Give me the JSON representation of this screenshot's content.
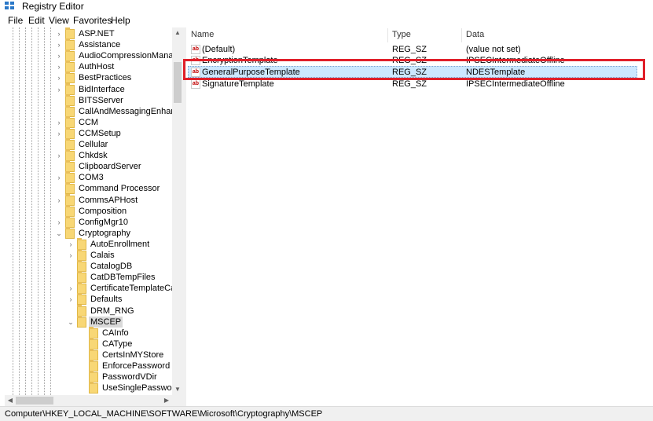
{
  "window": {
    "title": "Registry Editor"
  },
  "menu": [
    "File",
    "Edit",
    "View",
    "Favorites",
    "Help"
  ],
  "tree": {
    "items": [
      {
        "label": "ASP.NET",
        "expander": "›",
        "depth": 1
      },
      {
        "label": "Assistance",
        "expander": "›",
        "depth": 1
      },
      {
        "label": "AudioCompressionManager",
        "expander": "›",
        "depth": 1
      },
      {
        "label": "AuthHost",
        "expander": "›",
        "depth": 1
      },
      {
        "label": "BestPractices",
        "expander": "›",
        "depth": 1
      },
      {
        "label": "BidInterface",
        "expander": "›",
        "depth": 1
      },
      {
        "label": "BITSServer",
        "expander": "",
        "depth": 1
      },
      {
        "label": "CallAndMessagingEnhancem",
        "expander": "",
        "depth": 1
      },
      {
        "label": "CCM",
        "expander": "›",
        "depth": 1
      },
      {
        "label": "CCMSetup",
        "expander": "›",
        "depth": 1
      },
      {
        "label": "Cellular",
        "expander": "",
        "depth": 1
      },
      {
        "label": "Chkdsk",
        "expander": "›",
        "depth": 1
      },
      {
        "label": "ClipboardServer",
        "expander": "",
        "depth": 1
      },
      {
        "label": "COM3",
        "expander": "›",
        "depth": 1
      },
      {
        "label": "Command Processor",
        "expander": "",
        "depth": 1
      },
      {
        "label": "CommsAPHost",
        "expander": "›",
        "depth": 1
      },
      {
        "label": "Composition",
        "expander": "",
        "depth": 1
      },
      {
        "label": "ConfigMgr10",
        "expander": "›",
        "depth": 1
      },
      {
        "label": "Cryptography",
        "expander": "⌄",
        "depth": 1
      },
      {
        "label": "AutoEnrollment",
        "expander": "›",
        "depth": 2
      },
      {
        "label": "Calais",
        "expander": "›",
        "depth": 2
      },
      {
        "label": "CatalogDB",
        "expander": "",
        "depth": 2
      },
      {
        "label": "CatDBTempFiles",
        "expander": "",
        "depth": 2
      },
      {
        "label": "CertificateTemplateCache",
        "expander": "›",
        "depth": 2
      },
      {
        "label": "Defaults",
        "expander": "›",
        "depth": 2
      },
      {
        "label": "DRM_RNG",
        "expander": "",
        "depth": 2
      },
      {
        "label": "MSCEP",
        "expander": "⌄",
        "depth": 2,
        "selected": true
      },
      {
        "label": "CAInfo",
        "expander": "",
        "depth": 3
      },
      {
        "label": "CAType",
        "expander": "",
        "depth": 3
      },
      {
        "label": "CertsInMYStore",
        "expander": "",
        "depth": 3
      },
      {
        "label": "EnforcePassword",
        "expander": "",
        "depth": 3
      },
      {
        "label": "PasswordVDir",
        "expander": "",
        "depth": 3
      },
      {
        "label": "UseSinglePassword",
        "expander": "",
        "depth": 3
      }
    ]
  },
  "list": {
    "columns": [
      "Name",
      "Type",
      "Data"
    ],
    "rows": [
      {
        "name": "(Default)",
        "type": "REG_SZ",
        "data": "(value not set)"
      },
      {
        "name": "EncryptionTemplate",
        "type": "REG_SZ",
        "data": "IPSECIntermediateOffline"
      },
      {
        "name": "GeneralPurposeTemplate",
        "type": "REG_SZ",
        "data": "NDESTemplate",
        "selected": true
      },
      {
        "name": "SignatureTemplate",
        "type": "REG_SZ",
        "data": "IPSECIntermediateOffline"
      }
    ],
    "icon": "string-value-icon"
  },
  "status": {
    "path": "Computer\\HKEY_LOCAL_MACHINE\\SOFTWARE\\Microsoft\\Cryptography\\MSCEP"
  },
  "colors": {
    "highlight": "#e0202a",
    "selection": "#cce8ff",
    "folder": "#f8d775"
  }
}
